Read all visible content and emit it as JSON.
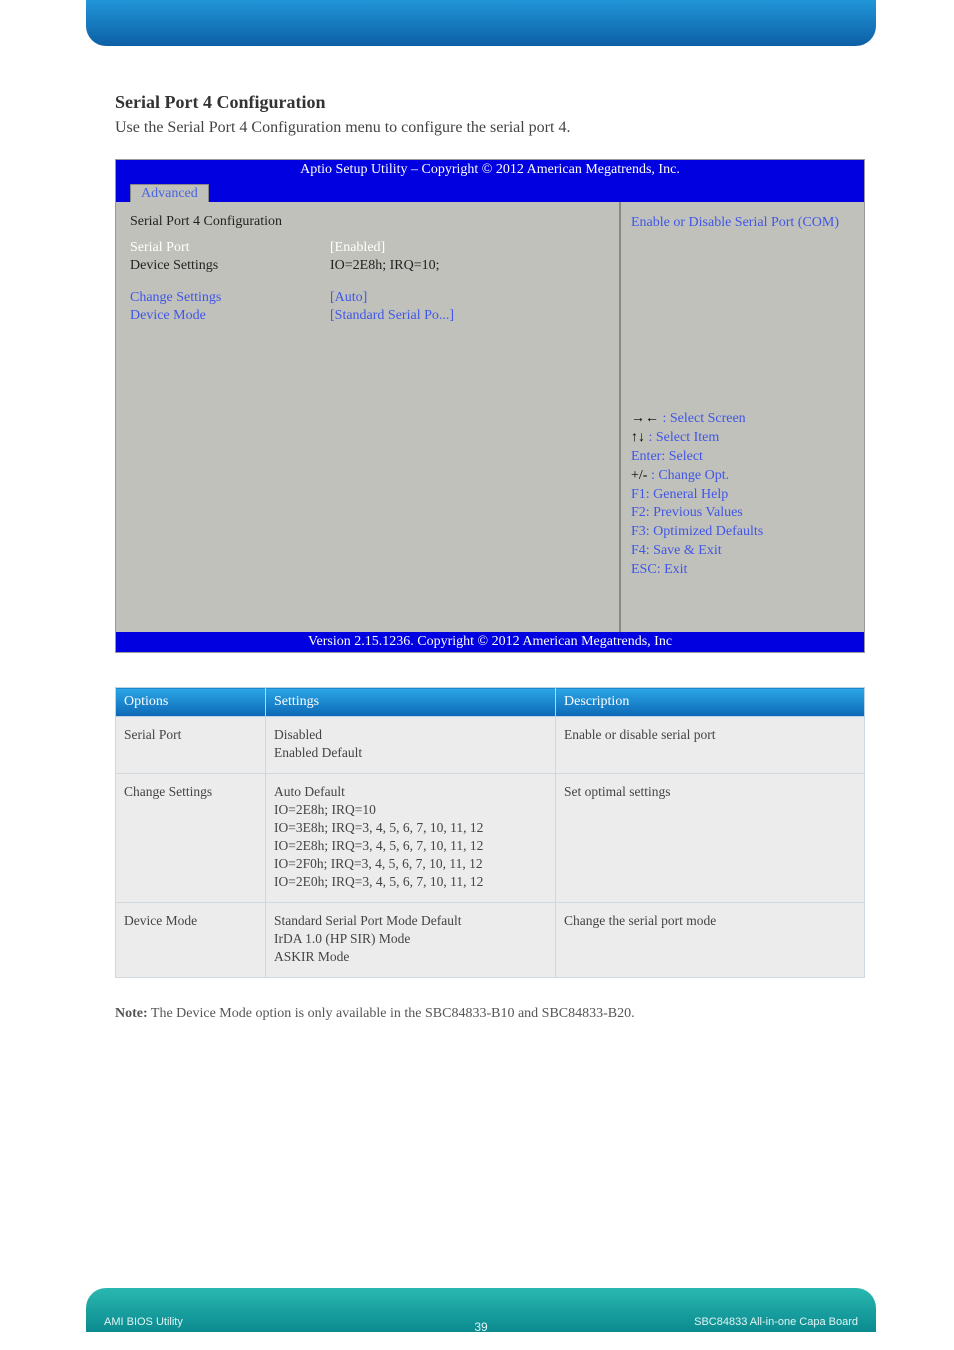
{
  "section": {
    "title": "Serial Port 4 Configuration",
    "desc": "Use the Serial Port 4 Configuration menu to configure the serial port 4."
  },
  "bios": {
    "title_bar": "Aptio Setup Utility  –  Copyright © 2012 American Megatrends, Inc.",
    "tab": "Advanced",
    "heading": "Serial Port 4 Configuration",
    "rows": [
      {
        "label": "Serial Port",
        "value": "[Enabled]",
        "lcls": "txt-white",
        "vcls": "txt-white"
      },
      {
        "label": "Device Settings",
        "value": "IO=2E8h; IRQ=10;",
        "lcls": "txt-black",
        "vcls": "txt-black"
      },
      {
        "label": "",
        "value": "",
        "lcls": "",
        "vcls": ""
      },
      {
        "label": "Change Settings",
        "value": "[Auto]",
        "lcls": "txt-blue",
        "vcls": "txt-blue"
      },
      {
        "label": "Device Mode",
        "value": "[Standard Serial Po...]",
        "lcls": "txt-blue",
        "vcls": "txt-blue"
      }
    ],
    "help": "Enable or Disable Serial Port (COM)",
    "nav": {
      "l1_sym": "→←",
      "l1_txt": " : Select Screen",
      "l2_sym": "↑↓",
      "l2_txt": " : Select Item",
      "l3_sym": "Enter",
      "l3_txt": ": Select",
      "l4_sym": "+/-",
      "l4_txt": " : Change Opt.",
      "l5_sym": "F1",
      "l5_txt": ": General Help",
      "l6_sym": "F2",
      "l6_txt": ": Previous Values",
      "l7_sym": "F3",
      "l7_txt": ": Optimized Defaults",
      "l8_sym": "F4",
      "l8_txt": ": Save & Exit",
      "l9_sym": "ESC",
      "l9_txt": ": Exit"
    },
    "version_bar": "Version 2.15.1236. Copyright © 2012 American Megatrends, Inc"
  },
  "opts": {
    "headers": {
      "c1": "Options",
      "c2": "Settings",
      "c3": "Description"
    },
    "rows": [
      {
        "c1": "Serial Port",
        "c2": [
          "Disabled",
          "Enabled                     Default"
        ],
        "c3": "Enable or disable serial port"
      },
      {
        "c1": "Change Settings",
        "c2": [
          "Auto                           Default",
          "IO=2E8h; IRQ=10",
          "IO=3E8h; IRQ=3, 4, 5, 6, 7, 10, 11, 12",
          "IO=2E8h; IRQ=3, 4, 5, 6, 7, 10, 11, 12",
          "IO=2F0h; IRQ=3, 4, 5, 6, 7, 10, 11, 12",
          "IO=2E0h; IRQ=3, 4, 5, 6, 7, 10, 11, 12"
        ],
        "c3": "Set optimal settings"
      },
      {
        "c1": "Device Mode",
        "c2": [
          "Standard Serial Port Mode Default",
          "IrDA 1.0 (HP SIR) Mode",
          "ASKIR Mode"
        ],
        "c3": "Change the serial port mode"
      }
    ]
  },
  "note": {
    "label": "Note:",
    "text": " The Device Mode option is only available in the SBC84833-B10 and SBC84833-B20."
  },
  "footer": {
    "left": "AMI BIOS Utility",
    "right": "SBC84833 All-in-one Capa Board",
    "page": "39"
  }
}
